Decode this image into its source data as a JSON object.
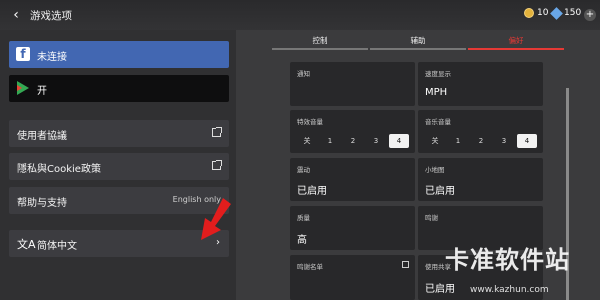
{
  "header": {
    "back_icon": "‹",
    "title": "游戏选项",
    "coins": "10",
    "gems": "150"
  },
  "left_menu": {
    "facebook_label": "未连接",
    "googleplay_label": "开",
    "terms_label": "使用者協議",
    "privacy_label": "隱私與Cookie政策",
    "help_label": "帮助与支持",
    "help_note": "English only",
    "language_label": "简体中文"
  },
  "tabs": [
    "控制",
    "辅助",
    "偏好"
  ],
  "cards": {
    "notify": {
      "title": "通知"
    },
    "speed": {
      "title": "速度显示",
      "value": "MPH"
    },
    "sfx": {
      "title": "特效音量",
      "options": [
        "关",
        "1",
        "2",
        "3",
        "4"
      ]
    },
    "music": {
      "title": "音乐音量",
      "options": [
        "关",
        "1",
        "2",
        "3",
        "4"
      ]
    },
    "vibration": {
      "title": "震动",
      "value": "已启用"
    },
    "minimap": {
      "title": "小地图",
      "value": "已启用"
    },
    "quality": {
      "title": "质量",
      "value": "高"
    },
    "credits": {
      "title": "鸣谢"
    },
    "credits_list": {
      "title": "鸣谢名单"
    },
    "share": {
      "title": "使用共享",
      "value": "已启用"
    }
  },
  "watermark": {
    "text": "卡准软件站",
    "url": "www.kazhun.com"
  },
  "colors": {
    "accent": "#e53935",
    "facebook": "#4267b2",
    "google_play": "#34a853"
  },
  "state": {
    "active_tab": "偏好",
    "sfx_volume": "4",
    "music_volume": "4"
  }
}
